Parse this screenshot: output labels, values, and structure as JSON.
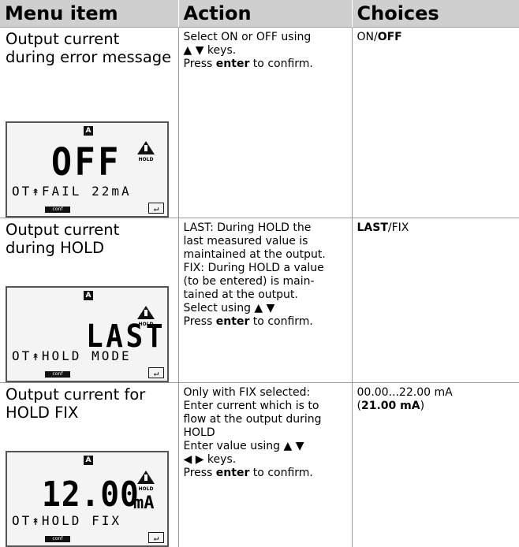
{
  "header": {
    "menu_item": "Menu item",
    "action": "Action",
    "choices": "Choices"
  },
  "rows": [
    {
      "title": "Output current during error message",
      "action_lines": [
        {
          "pre": "Select ON or OFF using",
          "bold": "",
          "post": ""
        },
        {
          "pre": "▲ ▼  keys.",
          "bold": "",
          "post": ""
        },
        {
          "pre": "Press ",
          "bold": "enter",
          "post": " to confirm."
        }
      ],
      "choice": {
        "pre": "ON/",
        "bold": "OFF",
        "post": ""
      },
      "lcd": {
        "indicator": "A",
        "big": "OFF",
        "unit": "",
        "small": "OT↟FAIL 22mA",
        "conf": "conf"
      }
    },
    {
      "title": "Output current during HOLD",
      "action_lines": [
        {
          "pre": "LAST:  During HOLD the",
          "bold": "",
          "post": ""
        },
        {
          "pre": "last measured value is",
          "bold": "",
          "post": ""
        },
        {
          "pre": "maintained at the output.",
          "bold": "",
          "post": ""
        },
        {
          "pre": "FIX:  During HOLD a value",
          "bold": "",
          "post": ""
        },
        {
          "pre": "(to be entered) is main-",
          "bold": "",
          "post": ""
        },
        {
          "pre": "tained at the output.",
          "bold": "",
          "post": ""
        },
        {
          "pre": "Select using  ▲ ▼",
          "bold": "",
          "post": ""
        },
        {
          "pre": "Press ",
          "bold": "enter",
          "post": " to confirm."
        }
      ],
      "choice": {
        "pre": "",
        "bold": "LAST",
        "post": "/FIX"
      },
      "lcd": {
        "indicator": "A",
        "big": "LAST",
        "unit": "",
        "small": "OT↟HOLD MODE",
        "conf": "conf"
      }
    },
    {
      "title": "Output current for HOLD FIX",
      "action_lines": [
        {
          "pre": "Only with FIX selected:",
          "bold": "",
          "post": ""
        },
        {
          "pre": "Enter current which is to",
          "bold": "",
          "post": ""
        },
        {
          "pre": "flow at the output during",
          "bold": "",
          "post": ""
        },
        {
          "pre": "HOLD",
          "bold": "",
          "post": ""
        },
        {
          "pre": "Enter value using  ▲ ▼",
          "bold": "",
          "post": ""
        },
        {
          "pre": "◀ ▶  keys.",
          "bold": "",
          "post": ""
        },
        {
          "pre": " ",
          "bold": "",
          "post": ""
        },
        {
          "pre": "Press ",
          "bold": "enter",
          "post": " to confirm."
        }
      ],
      "choice_lines": [
        {
          "pre": "00.00...22.00 mA",
          "bold": "",
          "post": ""
        },
        {
          "pre": "(",
          "bold": "21.00 mA",
          "post": ")"
        }
      ],
      "lcd": {
        "indicator": "A",
        "big": "12.00",
        "unit": "mA",
        "small": "OT↟HOLD FIX",
        "conf": "conf"
      }
    }
  ]
}
